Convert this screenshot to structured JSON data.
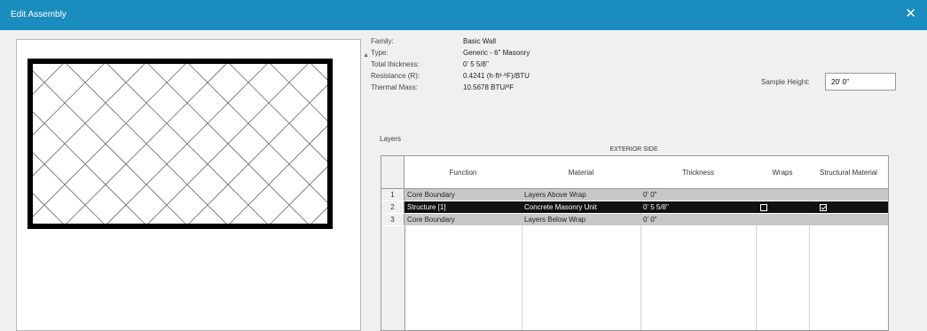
{
  "window": {
    "title": "Edit Assembly",
    "close_glyph": "✕"
  },
  "properties": [
    {
      "label": "Family:",
      "value": "Basic Wall"
    },
    {
      "label": "Type:",
      "value": "Generic - 6\" Masonry"
    },
    {
      "label": "Total thickness:",
      "value": "0' 5 5/8\""
    },
    {
      "label": "Resistance (R):",
      "value": "0.4241 (h·ft²·ºF)/BTU"
    },
    {
      "label": "Thermal Mass:",
      "value": "10.5678 BTU/ºF"
    }
  ],
  "sample_height": {
    "label": "Sample Height:",
    "value": "20' 0\""
  },
  "layers": {
    "label": "Layers",
    "exterior_label": "EXTERIOR SIDE",
    "columns": [
      "Function",
      "Material",
      "Thickness",
      "Wraps",
      "Structural Material"
    ],
    "rows": [
      {
        "num": "1",
        "function": "Core Boundary",
        "material": "Layers Above Wrap",
        "thickness": "0' 0\"",
        "wraps": false,
        "structural": false
      },
      {
        "num": "2",
        "function": "Structure [1]",
        "material": "Concrete Masonry Unit",
        "thickness": "0' 5 5/8\"",
        "wraps": false,
        "structural": true
      },
      {
        "num": "3",
        "function": "Core Boundary",
        "material": "Layers Below Wrap",
        "thickness": "0' 0\"",
        "wraps": false,
        "structural": false
      }
    ]
  },
  "icons": {
    "close": "close-icon",
    "scroll": "scroll-up-arrow-icon",
    "checkbox": "checkbox-icon"
  }
}
